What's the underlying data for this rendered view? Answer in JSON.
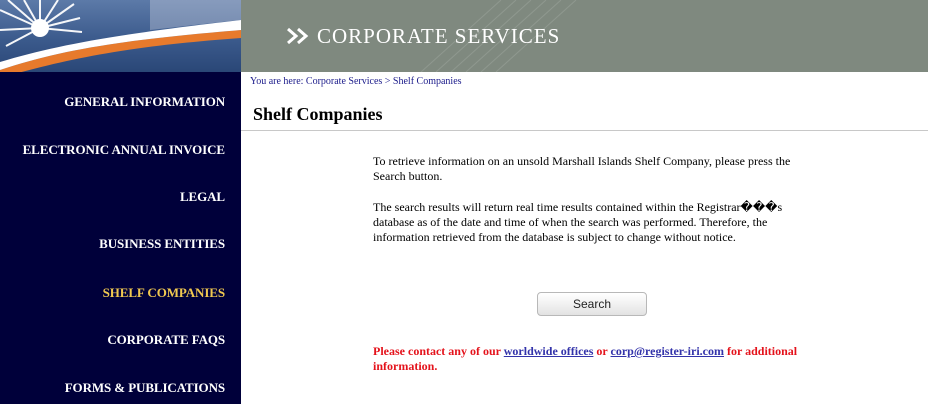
{
  "banner": {
    "title": "CORPORATE SERVICES",
    "background_color": "#7f897f",
    "chevron_icon": "double-chevron-right-icon"
  },
  "sidebar": {
    "background_color": "#00003a",
    "active_color": "#f0c850",
    "logo_icon": "flag-logo-icon",
    "items": [
      {
        "label": "GENERAL INFORMATION",
        "active": false
      },
      {
        "label": "ELECTRONIC ANNUAL INVOICE",
        "active": false
      },
      {
        "label": "LEGAL",
        "active": false
      },
      {
        "label": "BUSINESS ENTITIES",
        "active": false
      },
      {
        "label": "SHELF COMPANIES",
        "active": true
      },
      {
        "label": "CORPORATE FAQS",
        "active": false
      },
      {
        "label": "FORMS & PUBLICATIONS",
        "active": false
      }
    ]
  },
  "breadcrumb": {
    "text": "You are here: Corporate Services > Shelf Companies"
  },
  "main": {
    "title": "Shelf Companies",
    "paragraph1": "To retrieve information on an unsold Marshall Islands Shelf Company, please press the Search button.",
    "paragraph2": "The search results will return real time results contained within the Registrar���s database as of the date and time of when the search was performed. Therefore, the information retrieved from the database is subject to change without notice.",
    "search_button": "Search",
    "contact": {
      "prefix": "Please contact any of our ",
      "offices_link": "worldwide offices",
      "middle": " or ",
      "email_link": "corp@register-iri.com",
      "suffix": " for additional information.",
      "text_color": "#e4121b",
      "link_color": "#3333aa"
    }
  }
}
